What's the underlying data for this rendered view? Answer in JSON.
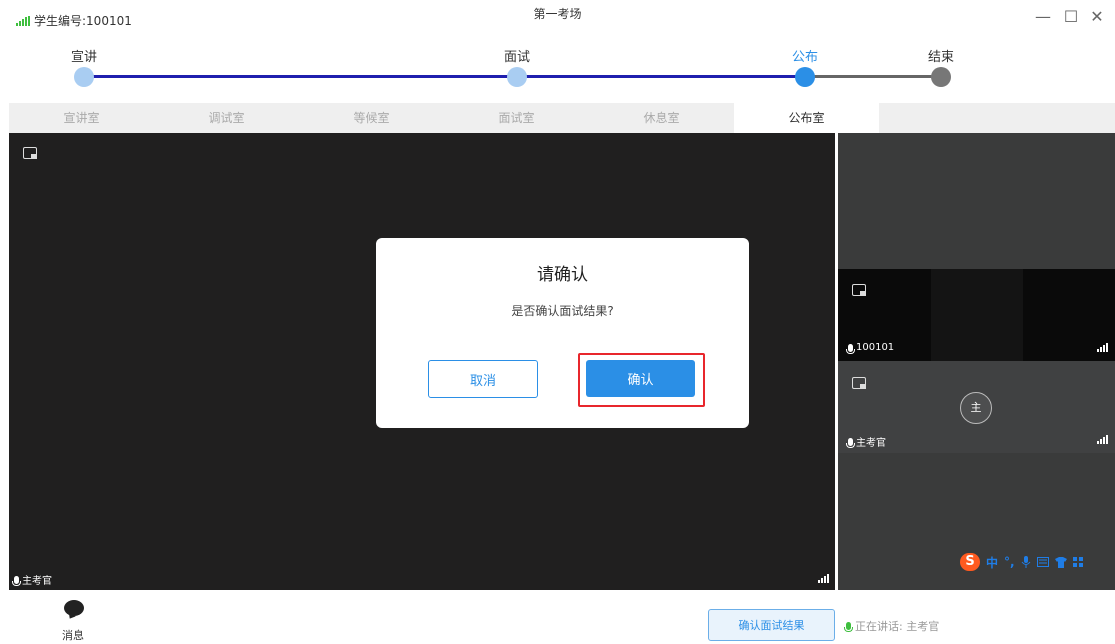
{
  "window": {
    "student_id_text": "学生编号:100101",
    "title": "第一考场",
    "minimize": "—",
    "maximize": "☐",
    "close": "✕"
  },
  "progress": {
    "stages": [
      {
        "label": "宣讲",
        "state": "done"
      },
      {
        "label": "面试",
        "state": "done"
      },
      {
        "label": "公布",
        "state": "current"
      },
      {
        "label": "结束",
        "state": "pending"
      }
    ],
    "colors": {
      "done_line": "#1f1fae",
      "pending_line": "#666666",
      "done_dot": "#a9cdf2",
      "current_dot": "#2b8fe6",
      "pending_dot": "#777777"
    }
  },
  "tabs": [
    "宣讲室",
    "调试室",
    "等候室",
    "面试室",
    "休息室",
    "公布室"
  ],
  "active_tab": "公布室",
  "main_video": {
    "speaker_label": "主考官"
  },
  "side_videos": [
    {
      "label": "100101"
    },
    {
      "label": "主考官",
      "avatar_text": "主"
    }
  ],
  "ime_bar": {
    "logo": "S",
    "lang": "中",
    "punct": "°,",
    "icons": [
      "mic-icon",
      "keyboard-icon",
      "shirt-icon",
      "grid-icon"
    ]
  },
  "dialog": {
    "title": "请确认",
    "message": "是否确认面试结果?",
    "cancel_label": "取消",
    "confirm_label": "确认"
  },
  "bottom": {
    "messages_label": "消息",
    "confirm_result_label": "确认面试结果",
    "speaking_text": "正在讲话: 主考官"
  },
  "accent_color": "#2b8fe6"
}
